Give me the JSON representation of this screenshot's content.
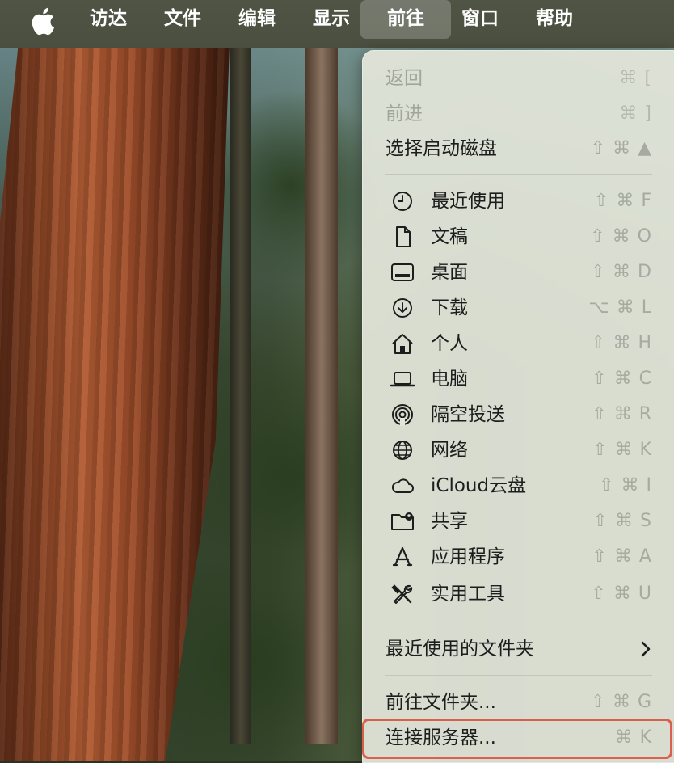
{
  "menubar": {
    "apple_icon": "apple-logo",
    "items": [
      "访达",
      "文件",
      "编辑",
      "显示",
      "前往",
      "窗口",
      "帮助"
    ],
    "active_item": "前往"
  },
  "go_menu": {
    "items": [
      {
        "label": "返回",
        "shortcut": "⌘ [",
        "enabled": false
      },
      {
        "label": "前进",
        "shortcut": "⌘ ]",
        "enabled": false
      },
      {
        "label": "选择启动磁盘",
        "shortcut": "⇧ ⌘ ▲",
        "enabled": true
      },
      {
        "label": "最近使用",
        "shortcut": "⇧ ⌘ F",
        "icon": "clock-icon"
      },
      {
        "label": "文稿",
        "shortcut": "⇧ ⌘ O",
        "icon": "document-icon"
      },
      {
        "label": "桌面",
        "shortcut": "⇧ ⌘ D",
        "icon": "desktop-icon"
      },
      {
        "label": "下载",
        "shortcut": "⌥ ⌘ L",
        "icon": "download-icon"
      },
      {
        "label": "个人",
        "shortcut": "⇧ ⌘ H",
        "icon": "home-icon"
      },
      {
        "label": "电脑",
        "shortcut": "⇧ ⌘ C",
        "icon": "laptop-icon"
      },
      {
        "label": "隔空投送",
        "shortcut": "⇧ ⌘ R",
        "icon": "airdrop-icon"
      },
      {
        "label": "网络",
        "shortcut": "⇧ ⌘ K",
        "icon": "globe-icon"
      },
      {
        "label": "iCloud云盘",
        "shortcut": "⇧ ⌘ I",
        "icon": "cloud-icon"
      },
      {
        "label": "共享",
        "shortcut": "⇧ ⌘ S",
        "icon": "shared-folder-icon"
      },
      {
        "label": "应用程序",
        "shortcut": "⇧ ⌘ A",
        "icon": "applications-icon"
      },
      {
        "label": "实用工具",
        "shortcut": "⇧ ⌘ U",
        "icon": "utilities-icon"
      },
      {
        "label": "最近使用的文件夹",
        "submenu": true,
        "icon": "chevron-right-icon"
      },
      {
        "label": "前往文件夹...",
        "shortcut": "⇧ ⌘ G"
      },
      {
        "label": "连接服务器...",
        "shortcut": "⌘ K",
        "highlighted": true
      }
    ]
  },
  "colors": {
    "menubar_bg": "#4b5041",
    "menu_bg": "#e2e5da",
    "highlight_border": "#d9604e",
    "disabled_text": "#a2a59c",
    "shortcut_text": "#a7aaa0"
  }
}
